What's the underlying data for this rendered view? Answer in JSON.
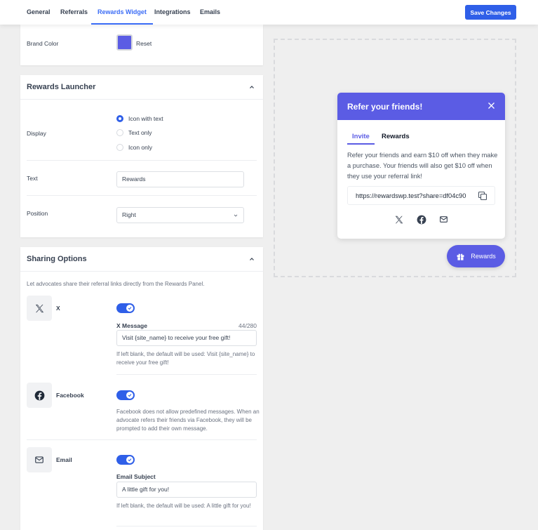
{
  "nav": {
    "tabs": [
      {
        "label": "General",
        "active": false
      },
      {
        "label": "Referrals",
        "active": false
      },
      {
        "label": "Rewards Widget",
        "active": true
      },
      {
        "label": "Integrations",
        "active": false
      },
      {
        "label": "Emails",
        "active": false
      }
    ],
    "save_label": "Save Changes"
  },
  "brand": {
    "label": "Brand Color",
    "color": "#5b5ce4",
    "reset_label": "Reset"
  },
  "launcher_settings": {
    "title": "Rewards Launcher",
    "display_label": "Display",
    "display_options": [
      {
        "label": "Icon with text",
        "selected": true
      },
      {
        "label": "Text only",
        "selected": false
      },
      {
        "label": "Icon only",
        "selected": false
      }
    ],
    "text_label": "Text",
    "text_value": "Rewards",
    "position_label": "Position",
    "position_value": "Right"
  },
  "sharing": {
    "title": "Sharing Options",
    "description": "Let advocates share their referral links directly from the Rewards Panel.",
    "x": {
      "name": "X",
      "enabled": true,
      "message_label": "X Message",
      "counter": "44/280",
      "message_value": "Visit {site_name} to receive your free gift!",
      "help": "If left blank, the default will be used: Visit {site_name} to receive your free gift!"
    },
    "facebook": {
      "name": "Facebook",
      "enabled": true,
      "help": "Facebook does not allow predefined messages. When an advocate refers their friends via Facebook, they will be prompted to add their own message."
    },
    "email": {
      "name": "Email",
      "enabled": true,
      "subject_label": "Email Subject",
      "subject_value": "A little gift for you!",
      "help": "If left blank, the default will be used: A little gift for you!"
    }
  },
  "preview": {
    "title": "Refer your friends!",
    "tabs": [
      {
        "label": "Invite",
        "active": true
      },
      {
        "label": "Rewards",
        "active": false
      }
    ],
    "text": "Refer your friends and earn $10 off when they make a purchase. Your friends will also get $10 off when they use your referral link!",
    "link": "https://rewardswp.test?share=df04c90",
    "share_icons": [
      "x-icon",
      "facebook-icon",
      "email-icon"
    ],
    "launcher_label": "Rewards"
  }
}
